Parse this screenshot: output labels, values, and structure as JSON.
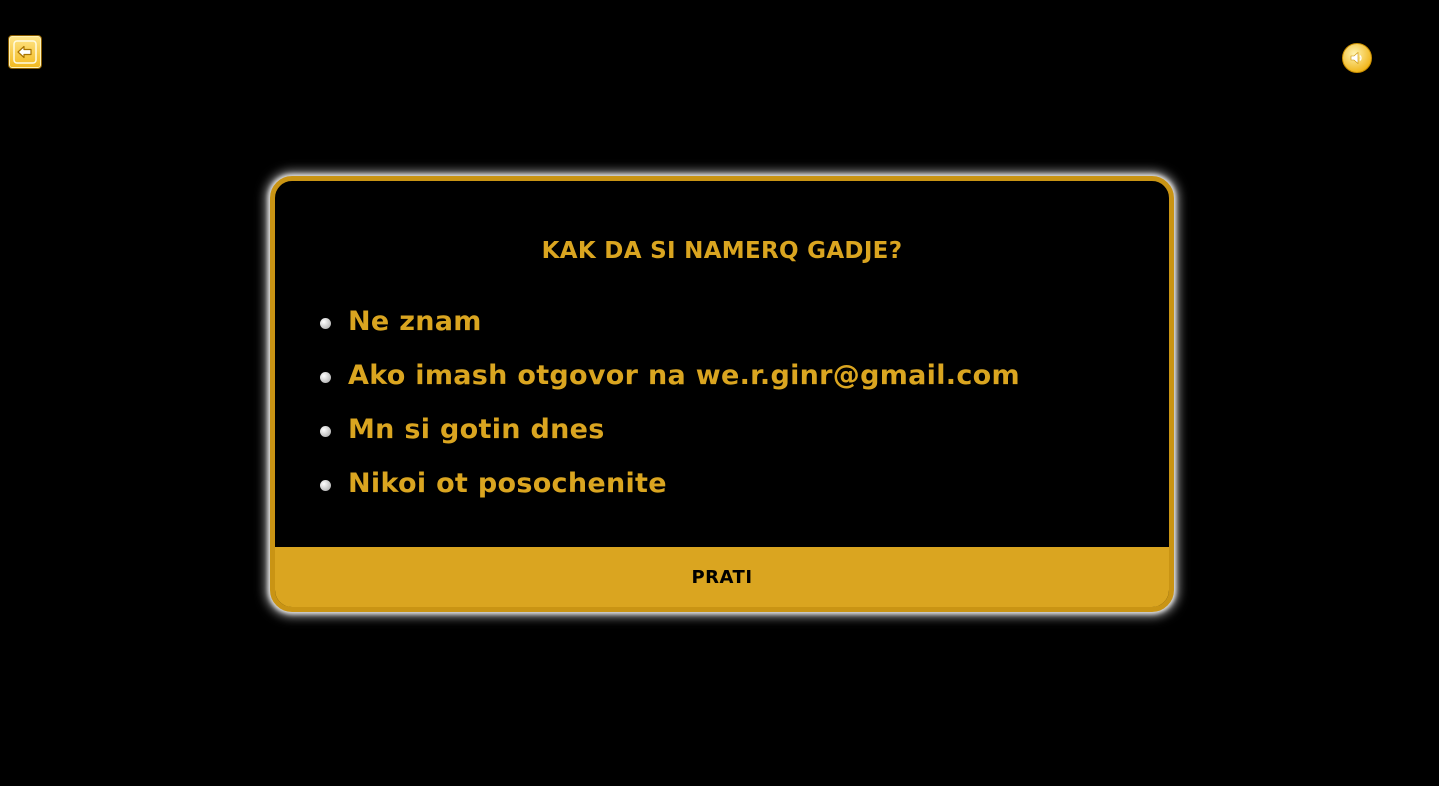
{
  "toolbar": {
    "back_icon": "arrow-left-icon",
    "sound_icon": "speaker-icon"
  },
  "dialog": {
    "question": "KAK DA SI NAMERQ GADJE?",
    "options": [
      {
        "label": "Ne znam"
      },
      {
        "label": "Ako imash otgovor na we.r.ginr@gmail.com"
      },
      {
        "label": "Mn si gotin dnes"
      },
      {
        "label": "Nikoi ot posochenite"
      }
    ],
    "submit_label": "PRATI"
  },
  "colors": {
    "background": "#000000",
    "accent": "#daa520",
    "border": "#c99414"
  }
}
